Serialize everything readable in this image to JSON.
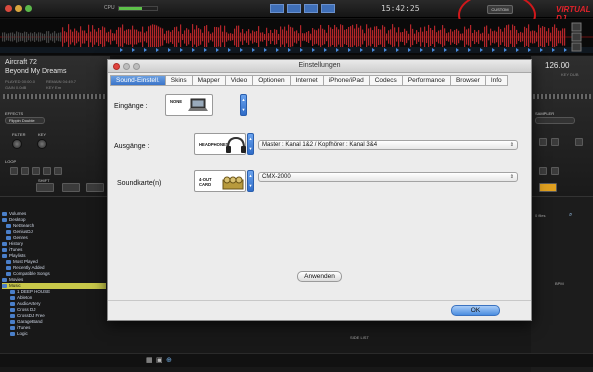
{
  "app": {
    "cpu_label": "CPU",
    "cpu_level": 0.6,
    "clock": "15:42:25",
    "mode_label": "CUSTOM",
    "brand": "VIRTUAL DJ",
    "accent_red": "#d0181b"
  },
  "deck_left": {
    "title": "Aircraft 72",
    "artist": "Beyond My Dreams",
    "info1": "PLAYED 00:00.0",
    "info2": "GAIN 0.0dB",
    "info3": "REMAIN 04:49.7",
    "info4": "KEY Em",
    "effects_label": "EFFECTS",
    "effect_value": "Flippin Double",
    "filter_label": "FILTER",
    "key_label": "KEY",
    "loop_label": "LOOP",
    "shift_label": "SHIFT"
  },
  "deck_right": {
    "bpm": "126.00",
    "bpm_label": "KEY DUB",
    "sampler_label": "SAMPLER"
  },
  "browser": {
    "tree": [
      "Volumes",
      "Desktop",
      "NetSearch",
      "GeniusDJ",
      "Genres",
      "History",
      "iTunes",
      "Playlists",
      "Most Played",
      "Recently Added",
      "Compatible Songs",
      "Movies",
      "Music",
      "1 DEEP HOUSE",
      "Ableton",
      "AudioArtery",
      "Cross DJ",
      "CrossDJ Free",
      "GarageBand",
      "iTunes",
      "Logic"
    ],
    "selected_index": 12,
    "files_label": "0 files",
    "side_list": "SIDE LIST",
    "col_bpm": "BPM"
  },
  "dialog": {
    "title": "Einstellungen",
    "tabs": [
      "Sound-Einstell.",
      "Skins",
      "Mapper",
      "Video",
      "Optionen",
      "Internet",
      "iPhone/iPad",
      "Codecs",
      "Performance",
      "Browser",
      "Info"
    ],
    "active_tab": 0,
    "inputs_label": "Eingänge :",
    "inputs_device": "NONE",
    "outputs_label": "Ausgänge :",
    "outputs_device": "HEADPHONES",
    "outputs_select": "Master : Kanal 1&2 / Kopfhörer : Kanal 3&4",
    "soundcard_label": "Soundkarte(n)",
    "soundcard_device": "4-OUT CARD",
    "soundcard_select": "CMX-2000",
    "apply_button": "Anwenden",
    "ok_button": "OK"
  }
}
